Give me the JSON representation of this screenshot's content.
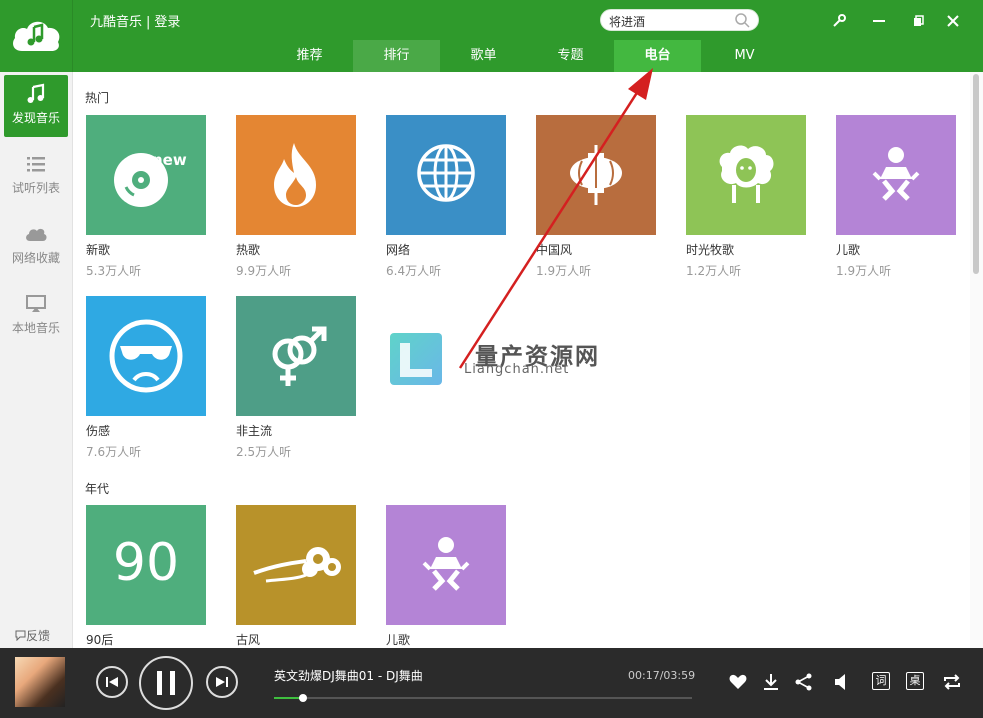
{
  "app": {
    "title": "九酷音乐",
    "separator": "|",
    "login": "登录",
    "search_value": "将进酒"
  },
  "tabs": [
    {
      "label": "推荐",
      "state": "normal"
    },
    {
      "label": "排行",
      "state": "hover"
    },
    {
      "label": "歌单",
      "state": "normal"
    },
    {
      "label": "专题",
      "state": "normal"
    },
    {
      "label": "电台",
      "state": "active"
    },
    {
      "label": "MV",
      "state": "normal"
    }
  ],
  "sidebar": {
    "items": [
      {
        "label": "发现音乐",
        "icon": "music-note-icon",
        "active": true
      },
      {
        "label": "试听列表",
        "icon": "list-icon",
        "active": false
      },
      {
        "label": "网络收藏",
        "icon": "cloud-icon",
        "active": false
      },
      {
        "label": "本地音乐",
        "icon": "monitor-icon",
        "active": false
      }
    ],
    "feedback": "反馈"
  },
  "sections": [
    {
      "title": "热门",
      "cards": [
        {
          "name": "新歌",
          "count": "5.3万人听",
          "color": "#4fae7d",
          "icon": "cd-new-icon"
        },
        {
          "name": "热歌",
          "count": "9.9万人听",
          "color": "#e48633",
          "icon": "flame-icon"
        },
        {
          "name": "网络",
          "count": "6.4万人听",
          "color": "#3a8fc6",
          "icon": "globe-icon"
        },
        {
          "name": "中国风",
          "count": "1.9万人听",
          "color": "#b86d3e",
          "icon": "lantern-icon"
        },
        {
          "name": "时光牧歌",
          "count": "1.2万人听",
          "color": "#8ec456",
          "icon": "sheep-icon"
        },
        {
          "name": "儿歌",
          "count": "1.9万人听",
          "color": "#b484d6",
          "icon": "baby-icon"
        },
        {
          "name": "伤感",
          "count": "7.6万人听",
          "color": "#2fa9e3",
          "icon": "sad-face-icon"
        },
        {
          "name": "非主流",
          "count": "2.5万人听",
          "color": "#4e9e87",
          "icon": "gender-icon"
        }
      ]
    },
    {
      "title": "年代",
      "cards": [
        {
          "name": "90后",
          "count": "",
          "color": "#4fae7d",
          "icon": "number-90-icon",
          "text": "90"
        },
        {
          "name": "古风",
          "count": "",
          "color": "#b8922a",
          "icon": "cloud-pattern-icon"
        },
        {
          "name": "儿歌",
          "count": "",
          "color": "#b484d6",
          "icon": "baby-icon"
        }
      ]
    }
  ],
  "player": {
    "song": "英文劲爆DJ舞曲01 - DJ舞曲",
    "time": "00:17/03:59",
    "progress": 0.07,
    "lyrics_label": "词",
    "desktop_label": "桌"
  },
  "watermark": {
    "title": "量产资源网",
    "subtitle": "Liangchan.net"
  },
  "colors": {
    "brand": "#2f9a2c",
    "tab_active": "#43b840",
    "player_bg": "#2b2b2b",
    "arrow": "#d42020"
  }
}
